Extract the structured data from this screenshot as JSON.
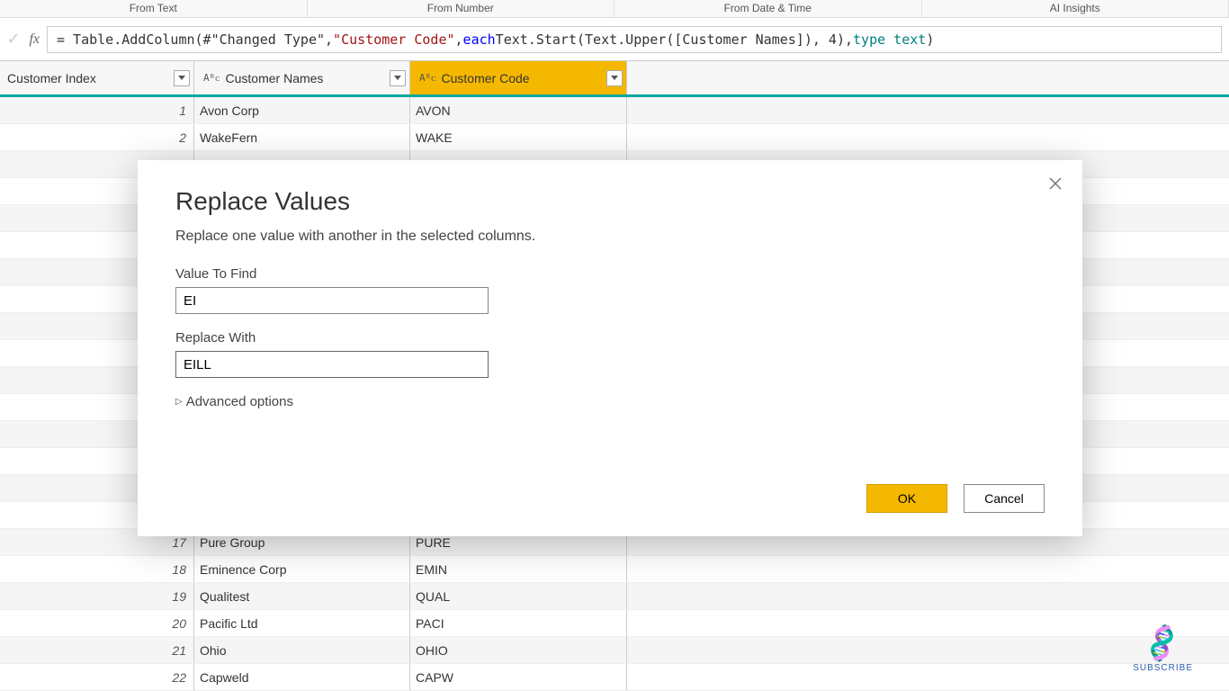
{
  "ribbon": {
    "tab1": "From Text",
    "tab2": "From Number",
    "tab3": "From Date & Time",
    "tab4": "AI Insights"
  },
  "formula": {
    "p1": "= Table.AddColumn(#\"Changed Type\", ",
    "p2": "\"Customer Code\"",
    "p3": ", ",
    "p4": "each",
    "p5": " Text.Start(Text.Upper([Customer Names]), 4), ",
    "p6": "type text",
    "p7": ")"
  },
  "columns": {
    "index": "Customer Index",
    "names": "Customer Names",
    "code": "Customer Code",
    "type_prefix": "Aᴮᴄ"
  },
  "rows": [
    {
      "idx": "1",
      "name": "Avon Corp",
      "code": "AVON"
    },
    {
      "idx": "2",
      "name": "WakeFern",
      "code": "WAKE"
    },
    {
      "idx": "",
      "name": "",
      "code": ""
    },
    {
      "idx": "",
      "name": "",
      "code": ""
    },
    {
      "idx": "",
      "name": "",
      "code": ""
    },
    {
      "idx": "",
      "name": "",
      "code": ""
    },
    {
      "idx": "",
      "name": "",
      "code": ""
    },
    {
      "idx": "",
      "name": "",
      "code": ""
    },
    {
      "idx": "",
      "name": "",
      "code": ""
    },
    {
      "idx": "",
      "name": "",
      "code": ""
    },
    {
      "idx": "",
      "name": "",
      "code": ""
    },
    {
      "idx": "",
      "name": "",
      "code": ""
    },
    {
      "idx": "",
      "name": "",
      "code": ""
    },
    {
      "idx": "",
      "name": "",
      "code": ""
    },
    {
      "idx": "",
      "name": "",
      "code": ""
    },
    {
      "idx": "",
      "name": "",
      "code": ""
    },
    {
      "idx": "17",
      "name": "Pure Group",
      "code": "PURE"
    },
    {
      "idx": "18",
      "name": "Eminence Corp",
      "code": "EMIN"
    },
    {
      "idx": "19",
      "name": "Qualitest",
      "code": "QUAL"
    },
    {
      "idx": "20",
      "name": "Pacific Ltd",
      "code": "PACI"
    },
    {
      "idx": "21",
      "name": "Ohio",
      "code": "OHIO"
    },
    {
      "idx": "22",
      "name": "Capweld",
      "code": "CAPW"
    }
  ],
  "dialog": {
    "title": "Replace Values",
    "desc": "Replace one value with another in the selected columns.",
    "label_find": "Value To Find",
    "value_find": "EI",
    "label_replace": "Replace With",
    "value_replace": "EILL",
    "advanced": "Advanced options",
    "ok": "OK",
    "cancel": "Cancel"
  },
  "footer": {
    "subscribe": "SUBSCRIBE"
  }
}
